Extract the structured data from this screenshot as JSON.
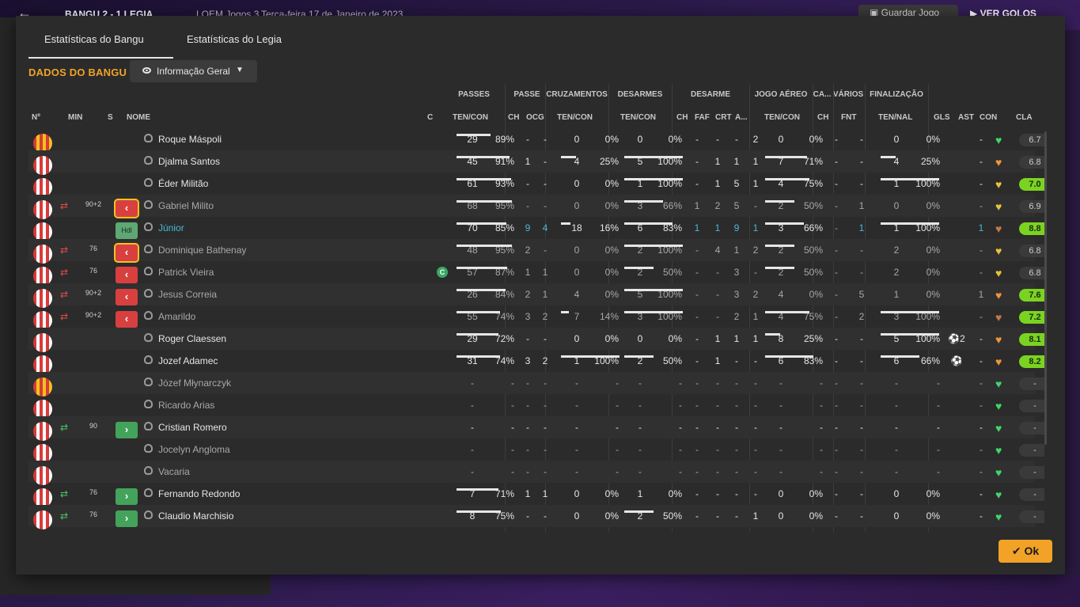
{
  "topbar": {
    "match": "BANGU 2 - 1 LEGIA",
    "competition": "LOEM Jogos 3",
    "date": "Terça-feira 17 de Janeiro de 2023",
    "save_label": "Guardar Jogo",
    "goals_label": "VER GOLOS"
  },
  "tabs": [
    "Estatísticas do Bangu",
    "Estatísticas do Legia"
  ],
  "team_label": "DADOS DO BANGU",
  "view_select": "Informação Geral",
  "groups": [
    "PASSES",
    "PASSE",
    "CRUZAMENTOS",
    "DESARMES",
    "DESARME",
    "JOGO AÉREO",
    "CA...",
    "VÁRIOS",
    "FINALIZAÇÃO"
  ],
  "headers": {
    "no": "Nº",
    "min": "MIN",
    "s": "S",
    "name": "NOME",
    "c": "C",
    "passes": "TEN/CON",
    "passe_ch": "CH",
    "passe_ocg": "OCG",
    "cruz": "TEN/CON",
    "des": "TEN/CON",
    "d_ch": "CH",
    "d_faf": "FAF",
    "d_crt": "CRT",
    "d_a": "A...",
    "aereo": "TEN/CON",
    "ca_ch": "CH",
    "fnt": "FNT",
    "fin": "TEN/NAL",
    "gls": "GLS",
    "ast": "AST",
    "con": "CON",
    "cla": "CLA"
  },
  "players": [
    {
      "kit": "gk",
      "sub": "",
      "min": "",
      "badge": "",
      "name": "Roque Máspoli",
      "cap": false,
      "dim": false,
      "link": false,
      "pa": "29",
      "pp": "89%",
      "pbar": 0.58,
      "ch": "-",
      "ocg": "-",
      "ct": "0",
      "cp": "0%",
      "cbar": 0,
      "dt": "0",
      "dp": "0%",
      "dbar": 0,
      "dch": "-",
      "faf": "-",
      "crt": "-",
      "da": "2",
      "at": "0",
      "ap": "0%",
      "abar": 0,
      "cach": "-",
      "fnt": "-",
      "ft": "0",
      "fp": "0%",
      "fbar": 0,
      "gls": "",
      "ast": "-",
      "con": "green",
      "cla": "6.7",
      "green": false
    },
    {
      "kit": "rw",
      "sub": "",
      "min": "",
      "badge": "",
      "name": "Djalma Santos",
      "cap": false,
      "dim": false,
      "link": false,
      "pa": "45",
      "pp": "91%",
      "pbar": 0.91,
      "ch": "1",
      "ocg": "-",
      "ct": "4",
      "cp": "25%",
      "cbar": 0.25,
      "dt": "5",
      "dp": "100%",
      "dbar": 1,
      "dch": "-",
      "faf": "1",
      "crt": "1",
      "da": "1",
      "at": "7",
      "ap": "71%",
      "abar": 0.71,
      "cach": "-",
      "fnt": "-",
      "ft": "4",
      "fp": "25%",
      "fbar": 0.25,
      "gls": "",
      "ast": "-",
      "con": "orange",
      "cla": "6.8",
      "green": false
    },
    {
      "kit": "rw",
      "sub": "",
      "min": "",
      "badge": "",
      "name": "Éder Militão",
      "cap": false,
      "dim": false,
      "link": false,
      "pa": "61",
      "pp": "93%",
      "pbar": 0.93,
      "ch": "-",
      "ocg": "-",
      "ct": "0",
      "cp": "0%",
      "cbar": 0,
      "dt": "1",
      "dp": "100%",
      "dbar": 1,
      "dch": "-",
      "faf": "1",
      "crt": "5",
      "da": "1",
      "at": "4",
      "ap": "75%",
      "abar": 0.75,
      "cach": "-",
      "fnt": "-",
      "ft": "1",
      "fp": "100%",
      "fbar": 1,
      "gls": "",
      "ast": "-",
      "con": "yellow",
      "cla": "7.0",
      "green": true
    },
    {
      "kit": "rw",
      "sub": "out",
      "min": "90+2",
      "badge": "out-yc",
      "name": "Gabriel Milito",
      "cap": false,
      "dim": true,
      "link": false,
      "pa": "68",
      "pp": "95%",
      "pbar": 0.95,
      "ch": "-",
      "ocg": "-",
      "ct": "0",
      "cp": "0%",
      "cbar": 0,
      "dt": "3",
      "dp": "66%",
      "dbar": 0.66,
      "dch": "1",
      "faf": "2",
      "crt": "5",
      "da": "-",
      "at": "2",
      "ap": "50%",
      "abar": 0.5,
      "cach": "-",
      "fnt": "1",
      "ft": "0",
      "fp": "0%",
      "fbar": 0,
      "gls": "",
      "ast": "-",
      "con": "yellow",
      "cla": "6.9",
      "green": false
    },
    {
      "kit": "rw",
      "sub": "",
      "min": "",
      "badge": "hdl",
      "name": "Júnior",
      "cap": false,
      "dim": false,
      "link": true,
      "pa": "70",
      "pp": "85%",
      "pbar": 0.85,
      "ch": "9",
      "ocg": "4",
      "ct": "18",
      "cp": "16%",
      "cbar": 0.16,
      "dt": "6",
      "dp": "83%",
      "dbar": 0.83,
      "dch": "1",
      "faf": "1",
      "crt": "9",
      "da": "1",
      "at": "3",
      "ap": "66%",
      "abar": 0.66,
      "cach": "-",
      "fnt": "1",
      "ft": "1",
      "fp": "100%",
      "fbar": 1,
      "gls": "",
      "ast": "1",
      "con": "brown",
      "cla": "8.8",
      "green": true,
      "blue": true
    },
    {
      "kit": "rw",
      "sub": "out",
      "min": "76",
      "badge": "out-yc",
      "name": "Dominique Bathenay",
      "cap": false,
      "dim": true,
      "link": false,
      "pa": "48",
      "pp": "95%",
      "pbar": 0.95,
      "ch": "2",
      "ocg": "-",
      "ct": "0",
      "cp": "0%",
      "cbar": 0,
      "dt": "2",
      "dp": "100%",
      "dbar": 1,
      "dch": "-",
      "faf": "4",
      "crt": "1",
      "da": "2",
      "at": "2",
      "ap": "50%",
      "abar": 0.5,
      "cach": "-",
      "fnt": "-",
      "ft": "2",
      "fp": "0%",
      "fbar": 0,
      "gls": "",
      "ast": "-",
      "con": "yellow",
      "cla": "6.8",
      "green": false
    },
    {
      "kit": "rw",
      "sub": "out",
      "min": "76",
      "badge": "out",
      "name": "Patrick Vieira",
      "cap": true,
      "cap_label": "C",
      "dim": true,
      "link": false,
      "pa": "57",
      "pp": "87%",
      "pbar": 0.87,
      "ch": "1",
      "ocg": "1",
      "ct": "0",
      "cp": "0%",
      "cbar": 0,
      "dt": "2",
      "dp": "50%",
      "dbar": 0.5,
      "dch": "-",
      "faf": "-",
      "crt": "3",
      "da": "-",
      "at": "2",
      "ap": "50%",
      "abar": 0.5,
      "cach": "-",
      "fnt": "-",
      "ft": "2",
      "fp": "0%",
      "fbar": 0,
      "gls": "",
      "ast": "-",
      "con": "yellow",
      "cla": "6.8",
      "green": false
    },
    {
      "kit": "rw",
      "sub": "out",
      "min": "90+2",
      "badge": "out",
      "name": "Jesus Correia",
      "cap": false,
      "dim": true,
      "link": false,
      "pa": "26",
      "pp": "84%",
      "pbar": 0.84,
      "ch": "2",
      "ocg": "1",
      "ct": "4",
      "cp": "0%",
      "cbar": 0,
      "dt": "5",
      "dp": "100%",
      "dbar": 1,
      "dch": "-",
      "faf": "-",
      "crt": "3",
      "da": "2",
      "at": "4",
      "ap": "0%",
      "abar": 0,
      "cach": "-",
      "fnt": "5",
      "ft": "1",
      "fp": "0%",
      "fbar": 0,
      "gls": "",
      "ast": "1",
      "con": "orange",
      "cla": "7.6",
      "green": true
    },
    {
      "kit": "rw",
      "sub": "out",
      "min": "90+2",
      "badge": "out",
      "name": "Amarildo",
      "cap": false,
      "dim": true,
      "link": false,
      "pa": "55",
      "pp": "74%",
      "pbar": 0.74,
      "ch": "3",
      "ocg": "2",
      "ct": "7",
      "cp": "14%",
      "cbar": 0.14,
      "dt": "3",
      "dp": "100%",
      "dbar": 1,
      "dch": "-",
      "faf": "-",
      "crt": "2",
      "da": "1",
      "at": "4",
      "ap": "75%",
      "abar": 0.75,
      "cach": "-",
      "fnt": "2",
      "ft": "3",
      "fp": "100%",
      "fbar": 1,
      "gls": "",
      "ast": "-",
      "con": "brown",
      "cla": "7.2",
      "green": true
    },
    {
      "kit": "rw",
      "sub": "",
      "min": "",
      "badge": "",
      "name": "Roger Claessen",
      "cap": false,
      "dim": false,
      "link": false,
      "pa": "29",
      "pp": "72%",
      "pbar": 0.72,
      "ch": "-",
      "ocg": "-",
      "ct": "0",
      "cp": "0%",
      "cbar": 0,
      "dt": "0",
      "dp": "0%",
      "dbar": 0,
      "dch": "-",
      "faf": "1",
      "crt": "1",
      "da": "1",
      "at": "8",
      "ap": "25%",
      "abar": 0.25,
      "cach": "-",
      "fnt": "-",
      "ft": "5",
      "fp": "100%",
      "fbar": 1,
      "gls": "⚽2",
      "ast": "-",
      "con": "orange",
      "cla": "8.1",
      "green": true
    },
    {
      "kit": "rw",
      "sub": "",
      "min": "",
      "badge": "",
      "name": "Jozef Adamec",
      "cap": false,
      "dim": false,
      "link": false,
      "pa": "31",
      "pp": "74%",
      "pbar": 0.74,
      "ch": "3",
      "ocg": "2",
      "ct": "1",
      "cp": "100%",
      "cbar": 1,
      "dt": "2",
      "dp": "50%",
      "dbar": 0.5,
      "dch": "-",
      "faf": "1",
      "crt": "-",
      "da": "-",
      "at": "6",
      "ap": "83%",
      "abar": 0.83,
      "cach": "-",
      "fnt": "-",
      "ft": "6",
      "fp": "66%",
      "fbar": 0.66,
      "gls": "⚽",
      "ast": "-",
      "con": "orange",
      "cla": "8.2",
      "green": true
    },
    {
      "kit": "gk",
      "sub": "",
      "min": "",
      "badge": "",
      "name": "Józef Młynarczyk",
      "cap": false,
      "dim": true,
      "link": false,
      "pa": "-",
      "pp": "-",
      "pbar": 0,
      "ch": "-",
      "ocg": "-",
      "ct": "-",
      "cp": "-",
      "cbar": 0,
      "dt": "-",
      "dp": "-",
      "dbar": 0,
      "dch": "-",
      "faf": "-",
      "crt": "-",
      "da": "-",
      "at": "-",
      "ap": "-",
      "abar": 0,
      "cach": "-",
      "fnt": "-",
      "ft": "-",
      "fp": "-",
      "fbar": 0,
      "gls": "",
      "ast": "-",
      "con": "green",
      "cla": "-",
      "green": false
    },
    {
      "kit": "rw",
      "sub": "",
      "min": "",
      "badge": "",
      "name": "Ricardo Arias",
      "cap": false,
      "dim": true,
      "link": false,
      "pa": "-",
      "pp": "-",
      "pbar": 0,
      "ch": "-",
      "ocg": "-",
      "ct": "-",
      "cp": "-",
      "cbar": 0,
      "dt": "-",
      "dp": "-",
      "dbar": 0,
      "dch": "-",
      "faf": "-",
      "crt": "-",
      "da": "-",
      "at": "-",
      "ap": "-",
      "abar": 0,
      "cach": "-",
      "fnt": "-",
      "ft": "-",
      "fp": "-",
      "fbar": 0,
      "gls": "",
      "ast": "-",
      "con": "green",
      "cla": "-",
      "green": false
    },
    {
      "kit": "rw",
      "sub": "in",
      "min": "90",
      "badge": "in",
      "name": "Cristian Romero",
      "cap": false,
      "dim": false,
      "link": false,
      "pa": "-",
      "pp": "-",
      "pbar": 0,
      "ch": "-",
      "ocg": "-",
      "ct": "-",
      "cp": "-",
      "cbar": 0,
      "dt": "-",
      "dp": "-",
      "dbar": 0,
      "dch": "-",
      "faf": "-",
      "crt": "-",
      "da": "-",
      "at": "-",
      "ap": "-",
      "abar": 0,
      "cach": "-",
      "fnt": "-",
      "ft": "-",
      "fp": "-",
      "fbar": 0,
      "gls": "",
      "ast": "-",
      "con": "green",
      "cla": "-",
      "green": false
    },
    {
      "kit": "rw",
      "sub": "",
      "min": "",
      "badge": "",
      "name": "Jocelyn Angloma",
      "cap": false,
      "dim": true,
      "link": false,
      "pa": "-",
      "pp": "-",
      "pbar": 0,
      "ch": "-",
      "ocg": "-",
      "ct": "-",
      "cp": "-",
      "cbar": 0,
      "dt": "-",
      "dp": "-",
      "dbar": 0,
      "dch": "-",
      "faf": "-",
      "crt": "-",
      "da": "-",
      "at": "-",
      "ap": "-",
      "abar": 0,
      "cach": "-",
      "fnt": "-",
      "ft": "-",
      "fp": "-",
      "fbar": 0,
      "gls": "",
      "ast": "-",
      "con": "green",
      "cla": "-",
      "green": false
    },
    {
      "kit": "rw",
      "sub": "",
      "min": "",
      "badge": "",
      "name": "Vacaria",
      "cap": false,
      "dim": true,
      "link": false,
      "pa": "-",
      "pp": "-",
      "pbar": 0,
      "ch": "-",
      "ocg": "-",
      "ct": "-",
      "cp": "-",
      "cbar": 0,
      "dt": "-",
      "dp": "-",
      "dbar": 0,
      "dch": "-",
      "faf": "-",
      "crt": "-",
      "da": "-",
      "at": "-",
      "ap": "-",
      "abar": 0,
      "cach": "-",
      "fnt": "-",
      "ft": "-",
      "fp": "-",
      "fbar": 0,
      "gls": "",
      "ast": "-",
      "con": "green",
      "cla": "-",
      "green": false
    },
    {
      "kit": "rw",
      "sub": "in",
      "min": "76",
      "badge": "in",
      "name": "Fernando Redondo",
      "cap": false,
      "dim": false,
      "link": false,
      "pa": "7",
      "pp": "71%",
      "pbar": 0.71,
      "ch": "1",
      "ocg": "1",
      "ct": "0",
      "cp": "0%",
      "cbar": 0,
      "dt": "1",
      "dp": "0%",
      "dbar": 0,
      "dch": "-",
      "faf": "-",
      "crt": "-",
      "da": "-",
      "at": "0",
      "ap": "0%",
      "abar": 0,
      "cach": "-",
      "fnt": "-",
      "ft": "0",
      "fp": "0%",
      "fbar": 0,
      "gls": "",
      "ast": "-",
      "con": "green",
      "cla": "-",
      "green": false
    },
    {
      "kit": "rw",
      "sub": "in",
      "min": "76",
      "badge": "in",
      "name": "Claudio Marchisio",
      "cap": false,
      "dim": false,
      "link": false,
      "pa": "8",
      "pp": "75%",
      "pbar": 0.75,
      "ch": "-",
      "ocg": "-",
      "ct": "0",
      "cp": "0%",
      "cbar": 0,
      "dt": "2",
      "dp": "50%",
      "dbar": 0.5,
      "dch": "-",
      "faf": "-",
      "crt": "-",
      "da": "1",
      "at": "0",
      "ap": "0%",
      "abar": 0,
      "cach": "-",
      "fnt": "-",
      "ft": "0",
      "fp": "0%",
      "fbar": 0,
      "gls": "",
      "ast": "-",
      "con": "green",
      "cla": "-",
      "green": false
    }
  ],
  "colors": {
    "accent": "#f2a227",
    "out": "#d84040",
    "in": "#43a35a",
    "rating_green": "#7bd321",
    "link": "#4bb7d8"
  },
  "icons": {
    "sub_out": "swap-arrows-icon",
    "sub_in": "swap-arrows-icon",
    "person": "person-icon",
    "heart": "heart-icon",
    "ok": "check-icon",
    "ball": "ball-icon"
  },
  "ok_label": "Ok"
}
